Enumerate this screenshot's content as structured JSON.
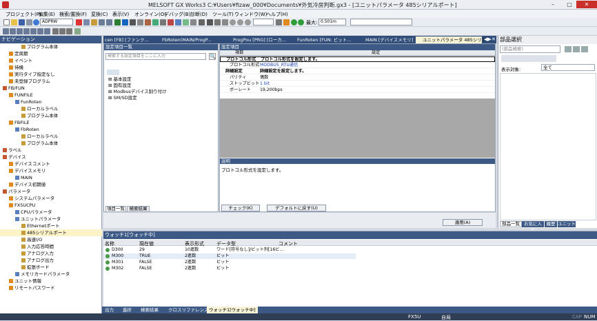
{
  "app": {
    "title": "MELSOFT GX Works3 C:¥Users¥fizaw_000¥Documents¥外気冷房判断.gx3 - [ユニットパラメータ 485シリアルポート]"
  },
  "menu": [
    "プロジェクト(P)",
    "編集(E)",
    "検索/置換(F)",
    "変換(C)",
    "表示(V)",
    "オンライン(O)",
    "デバッグ(B)",
    "診断(D)",
    "ツール(T)",
    "ウィンドウ(W)",
    "ヘルプ(H)"
  ],
  "toolbar": {
    "mode_value": "ADPRW",
    "max_label": "最大:",
    "max_value": "0.501m"
  },
  "nav": {
    "title": "ナビゲーション",
    "items": [
      {
        "label": "プログラム本体",
        "indent": 3
      },
      {
        "label": "定周期",
        "indent": 1
      },
      {
        "label": "イベント",
        "indent": 1
      },
      {
        "label": "待機",
        "indent": 1
      },
      {
        "label": "実行タイプ指定なし",
        "indent": 1
      },
      {
        "label": "未登録プログラム",
        "indent": 1
      },
      {
        "label": "FB/FUN",
        "indent": 0
      },
      {
        "label": "FUNFILE",
        "indent": 1
      },
      {
        "label": "FunRoten",
        "indent": 2
      },
      {
        "label": "ローカルラベル",
        "indent": 3
      },
      {
        "label": "プログラム本体",
        "indent": 3
      },
      {
        "label": "FBFILE",
        "indent": 1
      },
      {
        "label": "FbRoten",
        "indent": 2
      },
      {
        "label": "ローカルラベル",
        "indent": 3
      },
      {
        "label": "プログラム本体",
        "indent": 3
      },
      {
        "label": "ラベル",
        "indent": 0
      },
      {
        "label": "デバイス",
        "indent": 0
      },
      {
        "label": "デバイスコメント",
        "indent": 1
      },
      {
        "label": "デバイスメモリ",
        "indent": 1
      },
      {
        "label": "MAIN",
        "indent": 2
      },
      {
        "label": "デバイス初期値",
        "indent": 1
      },
      {
        "label": "パラメータ",
        "indent": 0
      },
      {
        "label": "システムパラメータ",
        "indent": 1
      },
      {
        "label": "FX5UCPU",
        "indent": 1
      },
      {
        "label": "CPUパラメータ",
        "indent": 2
      },
      {
        "label": "ユニットパラメータ",
        "indent": 2
      },
      {
        "label": "Ethernetポート",
        "indent": 3
      },
      {
        "label": "485シリアルポート",
        "indent": 3,
        "selected": true
      },
      {
        "label": "高速I/O",
        "indent": 3
      },
      {
        "label": "入力応答時間",
        "indent": 3
      },
      {
        "label": "アナログ入力",
        "indent": 3
      },
      {
        "label": "アナログ出力",
        "indent": 3
      },
      {
        "label": "拡張ボード",
        "indent": 3
      },
      {
        "label": "メモリカードパラメータ",
        "indent": 2
      },
      {
        "label": "ユニット情報",
        "indent": 1
      },
      {
        "label": "リモートパスワード",
        "indent": 1
      }
    ]
  },
  "tabs": [
    "cen [FB] [ファンク...",
    "FbRoten(MAIN/ProgP...",
    "ProgPou [PRG] [ローカ...",
    "FunRoten [FUN: ビット...",
    "MAIN [デバイスメモリ]",
    "ユニットパラメータ 485シリア..."
  ],
  "settings": {
    "left_header": "設定項目一覧",
    "search_placeholder": "検索する設定項目をここに入力",
    "tree": [
      "基本設定",
      "固有設定",
      "Modbusデバイス割り付け",
      "SM/SD設定"
    ],
    "left_tabs": [
      "項目一覧",
      "検索結果"
    ],
    "right_header": "設定項目",
    "col_item": "項目",
    "col_setting": "設定",
    "rows": [
      {
        "item": "プロトコル形式",
        "value": "プロトコル形式を設定します。",
        "bold": true
      },
      {
        "item": "プロトコル形式",
        "value": "MODBUS_RTU通信",
        "sub": true,
        "blue": true
      },
      {
        "item": "詳細設定",
        "value": "詳細設定を設定します。",
        "bold": true
      },
      {
        "item": "パリティ",
        "value": "偶数",
        "sub": true
      },
      {
        "item": "ストップビット",
        "value": "1 bit",
        "sub": true,
        "blue": true
      },
      {
        "item": "ボーレート",
        "value": "19,200bps",
        "sub": true
      }
    ],
    "desc_header": "説明",
    "desc_text": "プロトコル形式を設定します。",
    "check_btn": "チェック(K)",
    "default_btn": "デフォルトに戻す(U)",
    "apply_btn": "適用(A)"
  },
  "parts": {
    "title": "部品選択",
    "search_placeholder": "(部品検索)",
    "display_label": "表示対象:",
    "display_value": "全て",
    "tabs": [
      "部品一覧",
      "お気に入り",
      "履歴",
      "ユニット"
    ]
  },
  "watch": {
    "title": "ウォッチ1[ウォッチ中]",
    "cols": [
      "名称",
      "現在値",
      "表示形式",
      "データ型",
      "コメント"
    ],
    "rows": [
      {
        "name": "D300",
        "value": "29",
        "format": "10進数",
        "type": "ワード[符号なし]/ビット列[16ビ..."
      },
      {
        "name": "M300",
        "value": "TRUE",
        "format": "2進数",
        "type": "ビット"
      },
      {
        "name": "M301",
        "value": "FALSE",
        "format": "2進数",
        "type": "ビット"
      },
      {
        "name": "M302",
        "value": "FALSE",
        "format": "2進数",
        "type": "ビット"
      }
    ]
  },
  "bottom_tabs": [
    "出力",
    "進捗",
    "検索結果",
    "クロスリファレンス",
    "ウォッチ1[ウォッチ中]"
  ],
  "status": {
    "cpu": "FX5U",
    "station": "自局",
    "caps": "CAP",
    "num": "NUM"
  }
}
